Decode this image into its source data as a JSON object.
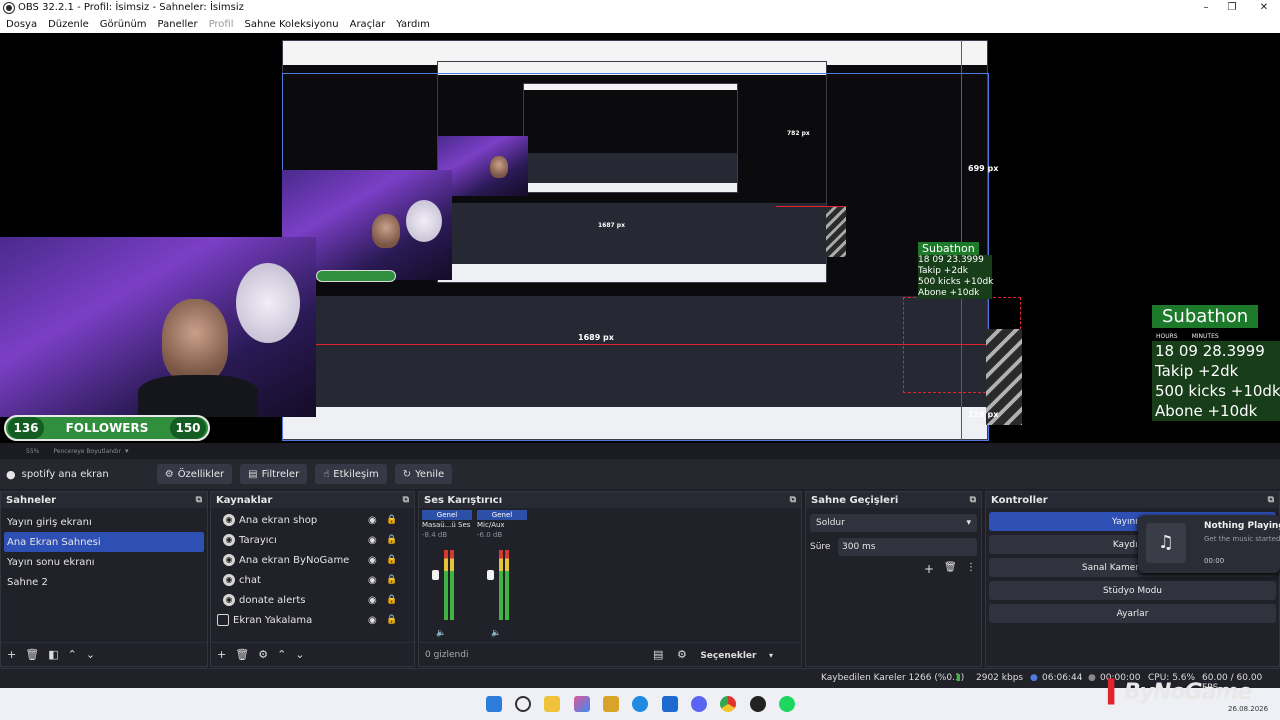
{
  "window": {
    "title": "OBS 32.2.1 - Profil: İsimsiz - Sahneler: İsimsiz",
    "minimize": "–",
    "maximize": "❐",
    "close": "✕"
  },
  "menu": [
    "Dosya",
    "Düzenle",
    "Görünüm",
    "Paneller",
    "Profil",
    "Sahne Koleksiyonu",
    "Araçlar",
    "Yardım"
  ],
  "preview": {
    "followers": {
      "count": "136",
      "label": "FOLLOWERS",
      "goal": "150"
    },
    "subathon": {
      "title": "Subathon",
      "hours_label": "HOURS",
      "minutes_label": "MINUTES",
      "timer": "18   09   28.3999",
      "lines": [
        "Takip +2dk",
        "500 kicks +10dk",
        "Abone +10dk"
      ]
    },
    "subathon_small": {
      "title": "Subathon",
      "timer": "18  09  23.3999",
      "lines": [
        "Takip +2dk",
        "500 kicks +10dk",
        "Abone +10dk"
      ]
    },
    "measure_labels": [
      "699 px",
      "1689 px",
      "126 px",
      "1687 px",
      "782 px"
    ],
    "zoom": "55%",
    "resize_label": "Pencereye Boyutlandır"
  },
  "toolbar": {
    "source_name": "spotify ana ekran",
    "properties": "Özellikler",
    "filters": "Filtreler",
    "interact": "Etkileşim",
    "refresh": "Yenile"
  },
  "scenes": {
    "title": "Sahneler",
    "items": [
      "Yayın giriş ekranı",
      "Ana Ekran Sahnesi",
      "Yayın sonu ekranı",
      "Sahne 2"
    ],
    "selected": 1
  },
  "sources": {
    "title": "Kaynaklar",
    "items": [
      "Ana ekran shop",
      "Tarayıcı",
      "Ana ekran ByNoGame",
      "chat",
      "donate alerts",
      "Ekran Yakalama"
    ]
  },
  "mixer": {
    "title": "Ses Karıştırıcı",
    "channels": [
      {
        "tag": "Genel",
        "name": "Masaü...ü Ses",
        "db": "-8.4 dB"
      },
      {
        "tag": "Genel",
        "name": "Mic/Aux",
        "db": "-6.0 dB"
      }
    ],
    "hidden": "0 gizlendi",
    "options": "Seçenekler"
  },
  "transitions": {
    "title": "Sahne Geçişleri",
    "type": "Soldur",
    "duration_label": "Süre",
    "duration": "300 ms"
  },
  "controls": {
    "title": "Kontroller",
    "buttons": [
      "Yayını Du",
      "Kaydı Ba",
      "Sanal Kamerayı Başlat",
      "Stüdyo Modu",
      "Ayarlar"
    ]
  },
  "now_playing": {
    "title": "Nothing Playing",
    "subtitle": "Get the music started",
    "time": "00:00"
  },
  "status": {
    "dropped": "Kaybedilen Kareler 1266 (%0.1)",
    "bitrate": "2902 kbps",
    "stream_time": "06:06:44",
    "rec_time": "00:00:00",
    "cpu": "CPU: 5.6%",
    "fps": "60.00 / 60.00 FPS"
  },
  "taskbar": {
    "date": "26.08.2026"
  },
  "brand": {
    "logo": "ByNoGame",
    "accent": "#e0232d",
    "selection": "#2e4fb4"
  }
}
